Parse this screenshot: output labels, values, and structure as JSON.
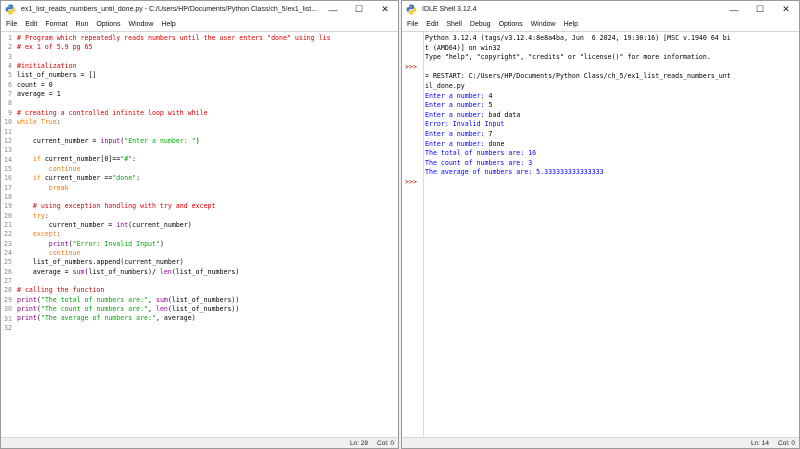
{
  "colors": {
    "keyword": "#ff7700",
    "builtin": "#900090",
    "string": "#00aa00",
    "comment": "#dd0000",
    "stdout": "#0000ff",
    "stderr": "#cc0000",
    "plain": "#000000",
    "prompt": "#c80000"
  },
  "editor": {
    "title": "ex1_list_reads_numbers_until_done.py - C:/Users/HP/Documents/Python Class/ch_5/ex1_list_rea...",
    "menu": [
      "File",
      "Edit",
      "Format",
      "Run",
      "Options",
      "Window",
      "Help"
    ],
    "controls": [
      "—",
      "☐",
      "✕"
    ],
    "line_numbers": [
      "1",
      "2",
      "3",
      "4",
      "5",
      "6",
      "7",
      "8",
      "9",
      "10",
      "11",
      "12",
      "13",
      "14",
      "15",
      "16",
      "17",
      "18",
      "19",
      "20",
      "21",
      "22",
      "23",
      "24",
      "25",
      "26",
      "27",
      "28",
      "29",
      "30",
      "31",
      "32"
    ],
    "lines": [
      [
        {
          "t": "# Program which repeatedly reads numbers until the user enters \"done\" using lis",
          "c": "comment"
        }
      ],
      [
        {
          "t": "# ex 1 of 5.9 pg 65",
          "c": "comment"
        }
      ],
      [],
      [
        {
          "t": "#initialization",
          "c": "comment"
        }
      ],
      [
        {
          "t": "list_of_numbers = []",
          "c": "plain"
        }
      ],
      [
        {
          "t": "count = 0",
          "c": "plain"
        }
      ],
      [
        {
          "t": "average = 1",
          "c": "plain"
        }
      ],
      [],
      [
        {
          "t": "# creating a controlled infinite loop with while",
          "c": "comment"
        }
      ],
      [
        {
          "t": "while",
          "c": "keyword"
        },
        {
          "t": " ",
          "c": "plain"
        },
        {
          "t": "True",
          "c": "keyword"
        },
        {
          "t": ":",
          "c": "plain"
        }
      ],
      [],
      [
        {
          "t": "    current_number = ",
          "c": "plain"
        },
        {
          "t": "input",
          "c": "builtin"
        },
        {
          "t": "(",
          "c": "plain"
        },
        {
          "t": "\"Enter a number: \"",
          "c": "string"
        },
        {
          "t": ")",
          "c": "plain"
        }
      ],
      [],
      [
        {
          "t": "    ",
          "c": "plain"
        },
        {
          "t": "if",
          "c": "keyword"
        },
        {
          "t": " current_number[0]==",
          "c": "plain"
        },
        {
          "t": "\"#\"",
          "c": "string"
        },
        {
          "t": ":",
          "c": "plain"
        }
      ],
      [
        {
          "t": "        ",
          "c": "plain"
        },
        {
          "t": "continue",
          "c": "keyword"
        }
      ],
      [
        {
          "t": "    ",
          "c": "plain"
        },
        {
          "t": "if",
          "c": "keyword"
        },
        {
          "t": " current_number ==",
          "c": "plain"
        },
        {
          "t": "\"done\"",
          "c": "string"
        },
        {
          "t": ":",
          "c": "plain"
        }
      ],
      [
        {
          "t": "        ",
          "c": "plain"
        },
        {
          "t": "break",
          "c": "keyword"
        }
      ],
      [],
      [
        {
          "t": "    # using exception handling with try and except",
          "c": "comment"
        }
      ],
      [
        {
          "t": "    ",
          "c": "plain"
        },
        {
          "t": "try",
          "c": "keyword"
        },
        {
          "t": ":",
          "c": "plain"
        }
      ],
      [
        {
          "t": "        current_number = ",
          "c": "plain"
        },
        {
          "t": "int",
          "c": "builtin"
        },
        {
          "t": "(current_number)",
          "c": "plain"
        }
      ],
      [
        {
          "t": "    ",
          "c": "plain"
        },
        {
          "t": "except",
          "c": "keyword"
        },
        {
          "t": ":",
          "c": "plain"
        }
      ],
      [
        {
          "t": "        ",
          "c": "plain"
        },
        {
          "t": "print",
          "c": "builtin"
        },
        {
          "t": "(",
          "c": "plain"
        },
        {
          "t": "\"Error: Invalid Input\"",
          "c": "string"
        },
        {
          "t": ")",
          "c": "plain"
        }
      ],
      [
        {
          "t": "        ",
          "c": "plain"
        },
        {
          "t": "continue",
          "c": "keyword"
        }
      ],
      [
        {
          "t": "    list_of_numbers.append(current_number)",
          "c": "plain"
        }
      ],
      [
        {
          "t": "    average = ",
          "c": "plain"
        },
        {
          "t": "sum",
          "c": "builtin"
        },
        {
          "t": "(list_of_numbers)/ ",
          "c": "plain"
        },
        {
          "t": "len",
          "c": "builtin"
        },
        {
          "t": "(list_of_numbers)",
          "c": "plain"
        }
      ],
      [],
      [
        {
          "t": "# calling the function",
          "c": "comment"
        }
      ],
      [
        {
          "t": "print",
          "c": "builtin"
        },
        {
          "t": "(",
          "c": "plain"
        },
        {
          "t": "\"The total of numbers are:\"",
          "c": "string"
        },
        {
          "t": ", ",
          "c": "plain"
        },
        {
          "t": "sum",
          "c": "builtin"
        },
        {
          "t": "(list_of_numbers))",
          "c": "plain"
        }
      ],
      [
        {
          "t": "print",
          "c": "builtin"
        },
        {
          "t": "(",
          "c": "plain"
        },
        {
          "t": "\"The count of numbers are:\"",
          "c": "string"
        },
        {
          "t": ", ",
          "c": "plain"
        },
        {
          "t": "len",
          "c": "builtin"
        },
        {
          "t": "(list_of_numbers))",
          "c": "plain"
        }
      ],
      [
        {
          "t": "print",
          "c": "builtin"
        },
        {
          "t": "(",
          "c": "plain"
        },
        {
          "t": "\"The average of numbers are:\"",
          "c": "string"
        },
        {
          "t": ", average)",
          "c": "plain"
        }
      ],
      []
    ],
    "status": {
      "line": "Ln: 28",
      "col": "Col: 0"
    }
  },
  "shell": {
    "title": "IDLE Shell 3.12.4",
    "menu": [
      "File",
      "Edit",
      "Shell",
      "Debug",
      "Options",
      "Window",
      "Help"
    ],
    "controls": [
      "—",
      "☐",
      "✕"
    ],
    "prompts": [
      ">>>",
      ">>>"
    ],
    "lines": [
      [
        {
          "t": "Python 3.12.4 (tags/v3.12.4:8e8a4ba, Jun  6 2024, 19:30:16) [MSC v.1940 64 bi",
          "c": "plain"
        }
      ],
      [
        {
          "t": "t (AMD64)] on win32",
          "c": "plain"
        }
      ],
      [
        {
          "t": "Type \"help\", \"copyright\", \"credits\" or \"license()\" for more information.",
          "c": "plain"
        }
      ],
      [],
      [
        {
          "t": "= RESTART: C:/Users/HP/Documents/Python Class/ch_5/ex1_list_reads_numbers_unt",
          "c": "plain"
        }
      ],
      [
        {
          "t": "il_done.py",
          "c": "plain"
        }
      ],
      [
        {
          "t": "Enter a number: ",
          "c": "stdout"
        },
        {
          "t": "4",
          "c": "plain"
        }
      ],
      [
        {
          "t": "Enter a number: ",
          "c": "stdout"
        },
        {
          "t": "5",
          "c": "plain"
        }
      ],
      [
        {
          "t": "Enter a number: ",
          "c": "stdout"
        },
        {
          "t": "bad data",
          "c": "plain"
        }
      ],
      [
        {
          "t": "Error: Invalid Input",
          "c": "stdout"
        }
      ],
      [
        {
          "t": "Enter a number: ",
          "c": "stdout"
        },
        {
          "t": "7",
          "c": "plain"
        }
      ],
      [
        {
          "t": "Enter a number: ",
          "c": "stdout"
        },
        {
          "t": "done",
          "c": "plain"
        }
      ],
      [
        {
          "t": "The total of numbers are: 16",
          "c": "stdout"
        }
      ],
      [
        {
          "t": "The count of numbers are: 3",
          "c": "stdout"
        }
      ],
      [
        {
          "t": "The average of numbers are: 5.333333333333333",
          "c": "stdout"
        }
      ],
      []
    ],
    "status": {
      "line": "Ln: 14",
      "col": "Col: 0"
    }
  }
}
